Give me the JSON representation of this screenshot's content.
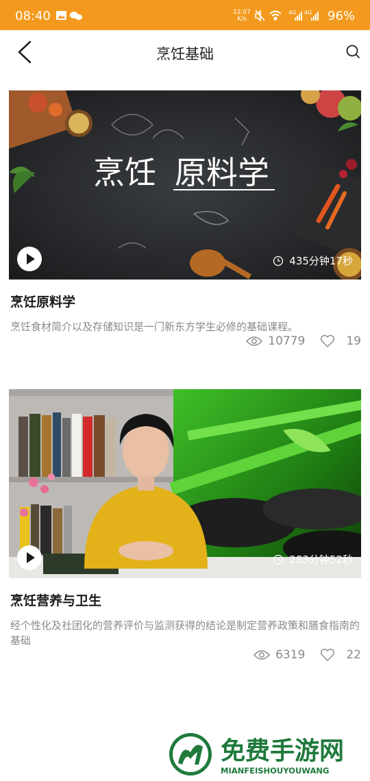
{
  "status_bar": {
    "time": "08:40",
    "net_speed_value": "12.07",
    "net_speed_unit": "K/s",
    "network_label": "4G",
    "battery": "96%"
  },
  "header": {
    "title": "烹饪基础"
  },
  "courses": [
    {
      "thumb_text_left": "烹饪",
      "thumb_text_right": "原料学",
      "duration": "435分钟17秒",
      "title": "烹饪原料学",
      "description": "烹饪食材简介以及存储知识是一门新东方学生必修的基础课程。",
      "views": "10779",
      "likes": "19"
    },
    {
      "duration": "283分钟52秒",
      "title": "烹饪营养与卫生",
      "description": "经个性化及社团化的营养评价与监测获得的结论是制定营养政策和膳食指南的基础",
      "views": "6319",
      "likes": "22"
    }
  ],
  "watermark": {
    "brand": "免费手游网",
    "site": "MIANFEISHOUYOUWANG"
  },
  "colors": {
    "status_bar": "#f39a1e",
    "title": "#1a1a1a",
    "secondary_text": "#8a8a8a",
    "watermark_green": "#1f7a3c"
  }
}
